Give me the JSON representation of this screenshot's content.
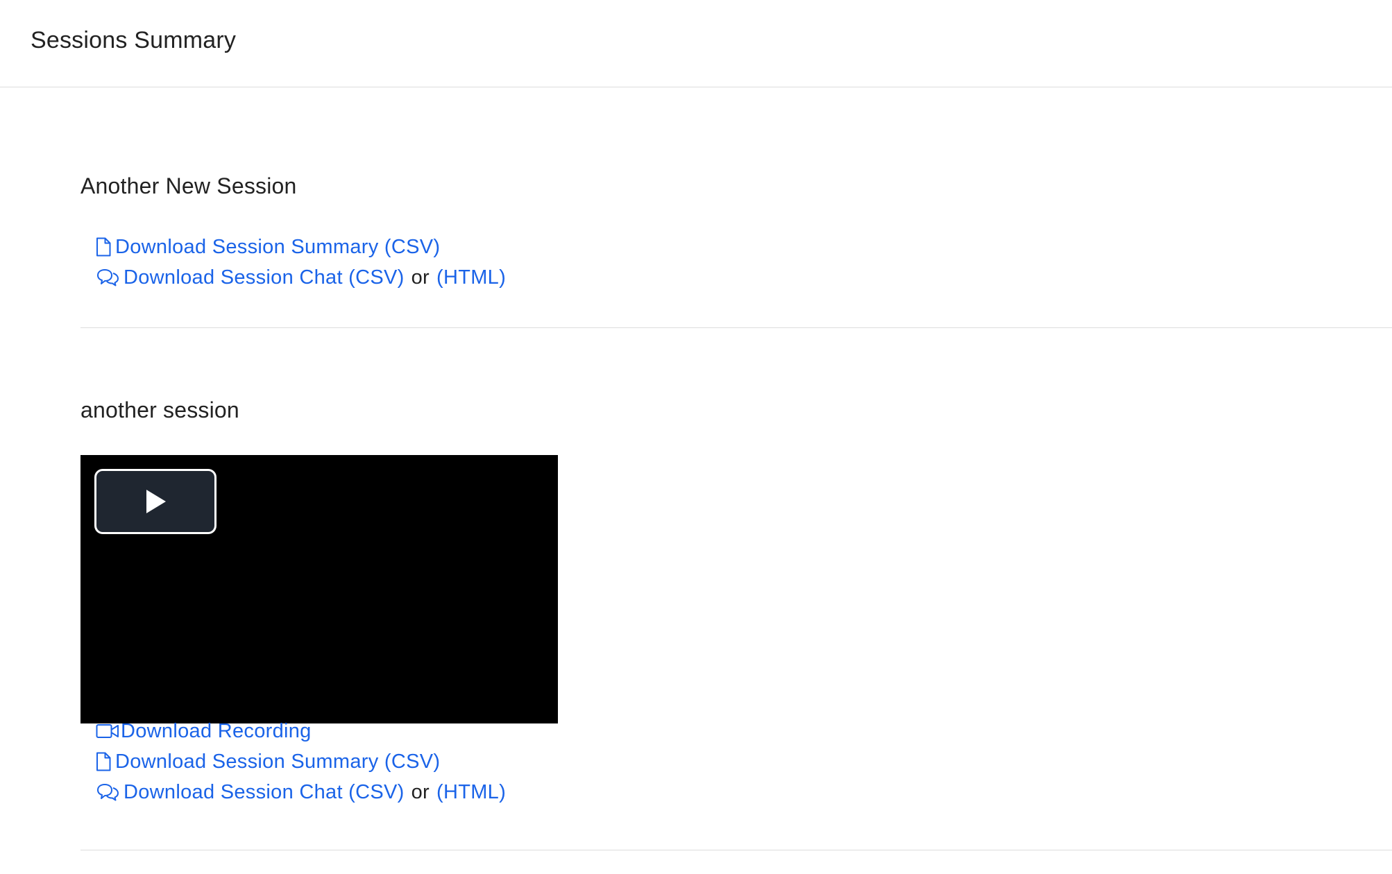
{
  "header": {
    "title": "Sessions Summary"
  },
  "sessions": [
    {
      "title": "Another New Session",
      "links": {
        "summary_csv": "Download Session Summary (CSV)",
        "chat_csv": "Download Session Chat (CSV)",
        "or": "or",
        "chat_html": "(HTML)"
      }
    },
    {
      "title": "another session",
      "video": {
        "play_icon": "play-icon"
      },
      "links": {
        "recording": "Download Recording",
        "summary_csv": "Download Session Summary (CSV)",
        "chat_csv": "Download Session Chat (CSV)",
        "or": "or",
        "chat_html": "(HTML)"
      }
    }
  ],
  "icons": {
    "summary": "file-icon",
    "chat": "chat-bubbles-icon",
    "recording": "video-camera-icon"
  },
  "colors": {
    "link": "#1a63e8",
    "text": "#222222",
    "divider": "#dcdcdc"
  }
}
